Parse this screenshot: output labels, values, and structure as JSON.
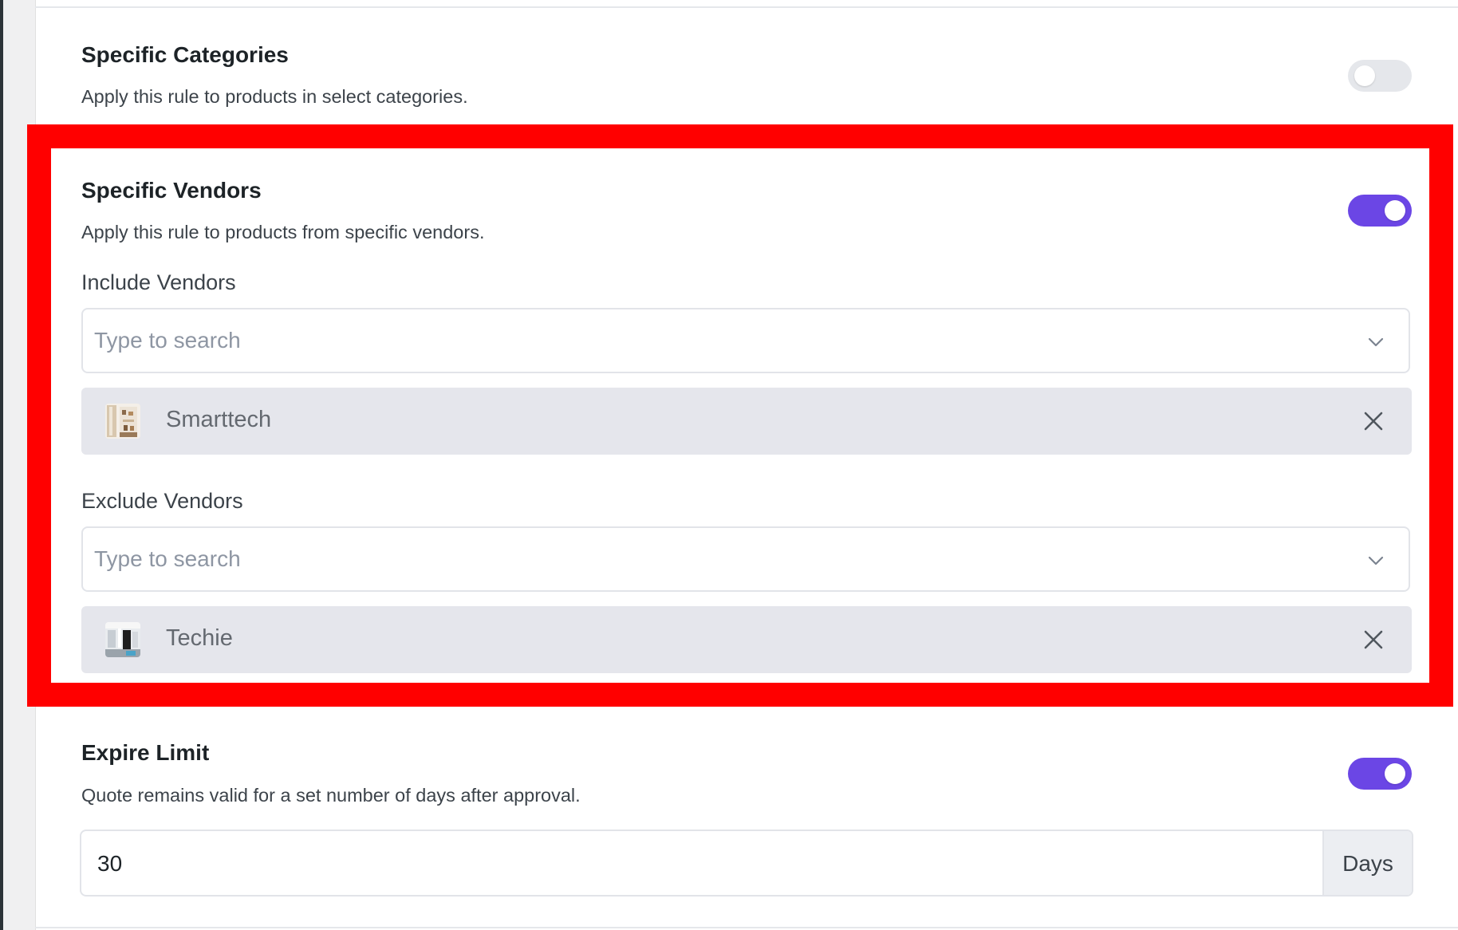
{
  "categories": {
    "title": "Specific Categories",
    "description": "Apply this rule to products in select categories.",
    "enabled": false
  },
  "vendors": {
    "title": "Specific Vendors",
    "description": "Apply this rule to products from specific vendors.",
    "enabled": true,
    "include": {
      "label": "Include Vendors",
      "placeholder": "Type to search",
      "selected": [
        "Smarttech"
      ]
    },
    "exclude": {
      "label": "Exclude Vendors",
      "placeholder": "Type to search",
      "selected": [
        "Techie"
      ]
    }
  },
  "expire": {
    "title": "Expire Limit",
    "description": "Quote remains valid for a set number of days after approval.",
    "enabled": true,
    "value": "30",
    "unit": "Days"
  },
  "colors": {
    "accent": "#6b46e5",
    "highlight": "#ff0000",
    "chip_bg": "#e5e6ec"
  },
  "icons": [
    "chevron-down-icon",
    "close-icon",
    "vendor-thumbnail"
  ]
}
